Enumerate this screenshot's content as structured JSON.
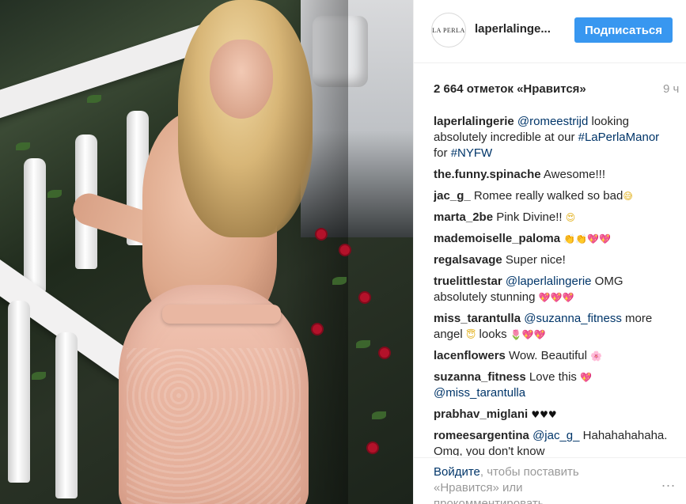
{
  "post": {
    "username": "laperlalinge...",
    "avatar_text": "LA PERLA",
    "follow_label": "Подписаться",
    "likes": "2 664 отметок «Нравится»",
    "time": "9 ч"
  },
  "comments": [
    {
      "author": "laperlalingerie",
      "parts": [
        {
          "t": " "
        },
        {
          "t": "@romeestrijd",
          "link": true
        },
        {
          "t": " looking absolutely incredible at our "
        },
        {
          "t": "#LaPerlaManor",
          "link": true
        },
        {
          "t": " for "
        },
        {
          "t": "#NYFW",
          "link": true
        }
      ]
    },
    {
      "author": "the.funny.spinache",
      "parts": [
        {
          "t": " Awesome!!!"
        }
      ]
    },
    {
      "author": "jac_g_",
      "parts": [
        {
          "t": " Romee really walked so bad"
        },
        {
          "t": "😅",
          "emoji": "yellow"
        }
      ]
    },
    {
      "author": "marta_2be",
      "parts": [
        {
          "t": " Pink Divine!! "
        },
        {
          "t": "😍",
          "emoji": "yellow"
        }
      ]
    },
    {
      "author": "mademoiselle_paloma",
      "parts": [
        {
          "t": " "
        },
        {
          "t": "👏👏",
          "emoji": "yellow"
        },
        {
          "t": "💖💖",
          "emoji": "red"
        }
      ]
    },
    {
      "author": "regalsavage",
      "parts": [
        {
          "t": " Super nice!"
        }
      ]
    },
    {
      "author": "truelittlestar",
      "parts": [
        {
          "t": " "
        },
        {
          "t": "@laperlalingerie",
          "link": true
        },
        {
          "t": " OMG absolutely stunning "
        },
        {
          "t": "💖💖💖",
          "emoji": "red"
        }
      ]
    },
    {
      "author": "miss_tarantulla",
      "parts": [
        {
          "t": " "
        },
        {
          "t": "@suzanna_fitness",
          "link": true
        },
        {
          "t": " more angel "
        },
        {
          "t": "😇",
          "emoji": "yellow"
        },
        {
          "t": " looks "
        },
        {
          "t": "🌷",
          "emoji": "red"
        },
        {
          "t": "💖💖",
          "emoji": "red"
        }
      ]
    },
    {
      "author": "lacenflowers",
      "parts": [
        {
          "t": " Wow. Beautiful "
        },
        {
          "t": "🌸",
          "emoji": "pink"
        }
      ]
    },
    {
      "author": "suzanna_fitness",
      "parts": [
        {
          "t": " Love this "
        },
        {
          "t": "💖",
          "emoji": "red"
        },
        {
          "t": " "
        },
        {
          "t": "@miss_tarantulla",
          "link": true
        }
      ]
    },
    {
      "author": "prabhav_miglani",
      "parts": [
        {
          "t": " "
        },
        {
          "t": "♥♥♥",
          "emoji": "black"
        }
      ]
    },
    {
      "author": "romeesargentina",
      "parts": [
        {
          "t": " "
        },
        {
          "t": "@jac_g_",
          "link": true
        },
        {
          "t": " Hahahahahaha. Omg, you don't know"
        }
      ]
    }
  ],
  "footer": {
    "login_link": "Войдите",
    "login_text": ", чтобы поставить «Нравится» или прокомментировать.",
    "more_label": "..."
  },
  "icons": {
    "more": "ellipsis-icon"
  }
}
